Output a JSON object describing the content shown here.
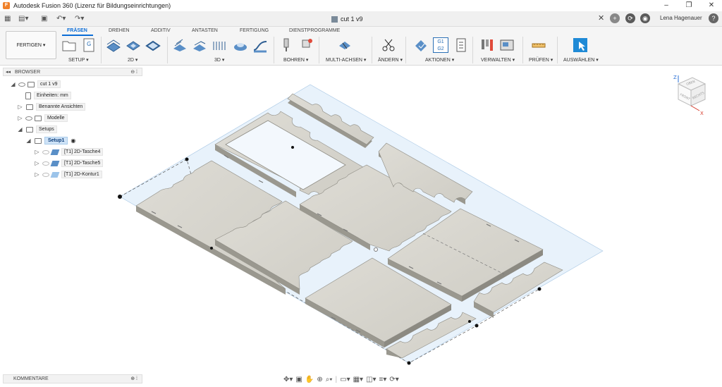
{
  "window": {
    "title": "Autodesk Fusion 360 (Lizenz für Bildungseinrichtungen)",
    "minimize": "–",
    "maximize": "❐",
    "close": "✕"
  },
  "header": {
    "document_tab": "cut 1 v9",
    "close_tab": "✕",
    "new_tab": "+",
    "user_name": "Lena Hagenauer",
    "help": "?"
  },
  "ribbon": {
    "workspace": "FERTIGEN ▾",
    "tabs": [
      "FRÄSEN",
      "DREHEN",
      "ADDITIV",
      "ANTASTEN",
      "FERTIGUNG",
      "DIENSTPROGRAMME"
    ],
    "groups": [
      "SETUP ▾",
      "2D ▾",
      "3D ▾",
      "BOHREN ▾",
      "MULTI-ACHSEN ▾",
      "ÄNDERN ▾",
      "AKTIONEN ▾",
      "VERWALTEN ▾",
      "PRÜFEN ▾",
      "AUSWÄHLEN ▾"
    ],
    "g1g2": "G1 G2"
  },
  "browser": {
    "title": "BROWSER",
    "root": "cut 1 v9",
    "units": "Einheiten: mm",
    "named_views": "Benannte Ansichten",
    "models": "Modelle",
    "setups": "Setups",
    "setup1": "Setup1",
    "ops": [
      "[T1] 2D-Tasche4",
      "[T1] 2D-Tasche5",
      "[T1] 2D-Kontur1"
    ]
  },
  "comments": {
    "label": "KOMMENTARE"
  },
  "viewcube": {
    "front": "FRONT",
    "right": "RECHTS",
    "top": "OBEN",
    "z": "Z",
    "x": "X"
  },
  "colors": {
    "accent": "#0a6cd6",
    "part_fill": "#d8d6cf",
    "part_side": "#9a988f",
    "stock_plane": "#e8f2fb"
  }
}
